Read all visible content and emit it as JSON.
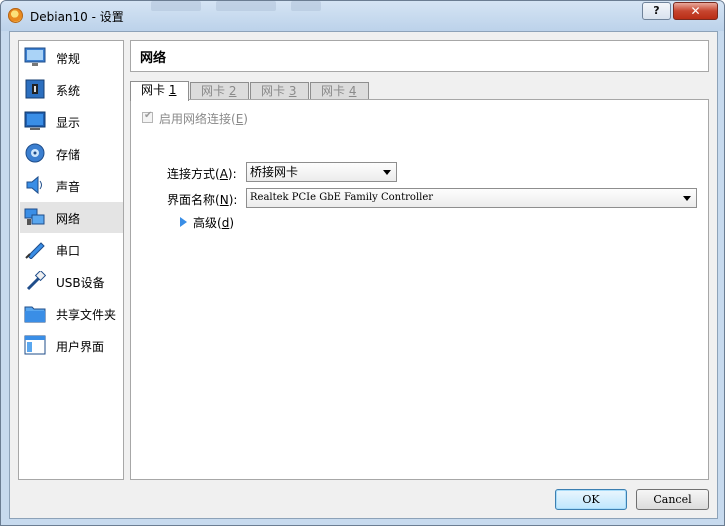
{
  "window": {
    "title": "Debian10 - 设置",
    "help_label": "?",
    "close_label": "✕"
  },
  "sidebar": {
    "selected_index": 5,
    "items": [
      {
        "label": "常规",
        "icon": "general-icon"
      },
      {
        "label": "系统",
        "icon": "system-icon"
      },
      {
        "label": "显示",
        "icon": "display-icon"
      },
      {
        "label": "存储",
        "icon": "storage-icon"
      },
      {
        "label": "声音",
        "icon": "audio-icon"
      },
      {
        "label": "网络",
        "icon": "network-icon"
      },
      {
        "label": "串口",
        "icon": "serial-port-icon"
      },
      {
        "label": "USB设备",
        "icon": "usb-icon"
      },
      {
        "label": "共享文件夹",
        "icon": "shared-folder-icon"
      },
      {
        "label": "用户界面",
        "icon": "user-interface-icon"
      }
    ]
  },
  "header": {
    "title": "网络"
  },
  "tabs": [
    {
      "label": "网卡",
      "num": "1"
    },
    {
      "label": "网卡",
      "num": "2"
    },
    {
      "label": "网卡",
      "num": "3"
    },
    {
      "label": "网卡",
      "num": "4"
    }
  ],
  "network": {
    "enable_label": "启用网络连接",
    "enable_key": "E",
    "enabled": true,
    "attached_label": "连接方式",
    "attached_key": "A",
    "attached_value": "桥接网卡",
    "name_label": "界面名称",
    "name_key": "N",
    "name_value": "Realtek PCIe GbE Family Controller",
    "advanced_label": "高级",
    "advanced_key": "d"
  },
  "buttons": {
    "ok": "OK",
    "cancel": "Cancel"
  },
  "colors": {
    "titlebar": "#c7daee",
    "close": "#c7452f",
    "accent": "#3a8ee6"
  }
}
